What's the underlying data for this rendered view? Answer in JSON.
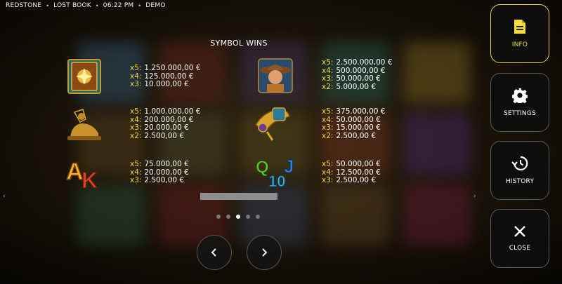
{
  "topbar": {
    "brand": "REDSTONE",
    "game": "LOST BOOK",
    "time": "06:22 PM",
    "mode": "DEMO"
  },
  "title": "SYMBOL WINS",
  "symbols": [
    {
      "icon": "book-icon",
      "pays": [
        {
          "mult": "x5:",
          "value": "1.250.000,00 €"
        },
        {
          "mult": "x4:",
          "value": "125.000,00 €"
        },
        {
          "mult": "x3:",
          "value": "10.000,00 €"
        }
      ]
    },
    {
      "icon": "explorer-icon",
      "pays": [
        {
          "mult": "x5:",
          "value": "2.500.000,00 €"
        },
        {
          "mult": "x4:",
          "value": "500.000,00 €"
        },
        {
          "mult": "x3:",
          "value": "50.000,00 €"
        },
        {
          "mult": "x2:",
          "value": "5.000,00 €"
        }
      ]
    },
    {
      "icon": "sphinx-icon",
      "pays": [
        {
          "mult": "x5:",
          "value": "1.000.000,00 €"
        },
        {
          "mult": "x4:",
          "value": "200.000,00 €"
        },
        {
          "mult": "x3:",
          "value": "20.000,00 €"
        },
        {
          "mult": "x2:",
          "value": "2.500,00 €"
        }
      ]
    },
    {
      "icon": "scarab-amulet-icon",
      "pays": [
        {
          "mult": "x5:",
          "value": "375.000,00 €"
        },
        {
          "mult": "x4:",
          "value": "50.000,00 €"
        },
        {
          "mult": "x3:",
          "value": "15.000,00 €"
        },
        {
          "mult": "x2:",
          "value": "2.500,00 €"
        }
      ]
    },
    {
      "icon": "ace-king-icon",
      "pays": [
        {
          "mult": "x5:",
          "value": "75.000,00 €"
        },
        {
          "mult": "x4:",
          "value": "20.000,00 €"
        },
        {
          "mult": "x3:",
          "value": "2.500,00 €"
        }
      ]
    },
    {
      "icon": "queen-jack-ten-icon",
      "pays": [
        {
          "mult": "x5:",
          "value": "50.000,00 €"
        },
        {
          "mult": "x4:",
          "value": "12.500,00 €"
        },
        {
          "mult": "x3:",
          "value": "2.500,00 €"
        }
      ]
    }
  ],
  "pager": {
    "current_page": 3,
    "total_pages": 5
  },
  "sidebar": {
    "info": "INFO",
    "settings": "SETTINGS",
    "history": "HISTORY",
    "close": "CLOSE"
  },
  "colors": {
    "accent": "#f3dd3a",
    "multiplier": "#f5d84a"
  }
}
